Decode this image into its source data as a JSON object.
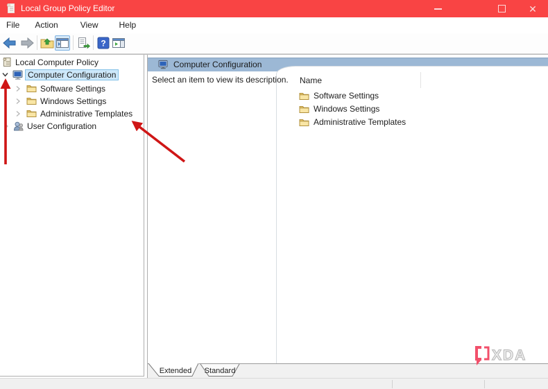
{
  "window": {
    "title": "Local Group Policy Editor",
    "controls": {
      "minimize": "minimize",
      "maximize": "maximize",
      "close": "close"
    }
  },
  "menu": {
    "items": [
      {
        "label": "File"
      },
      {
        "label": "Action"
      },
      {
        "label": "View"
      },
      {
        "label": "Help"
      }
    ]
  },
  "toolbar": {
    "buttons": [
      {
        "name": "back"
      },
      {
        "name": "forward"
      },
      {
        "name": "up-one-level"
      },
      {
        "name": "show-console-tree",
        "pressed": true
      },
      {
        "name": "export-list"
      },
      {
        "name": "help"
      },
      {
        "name": "show-action-pane"
      }
    ],
    "help_glyph": "?"
  },
  "tree": {
    "root": {
      "label": "Local Computer Policy"
    },
    "computer": {
      "label": "Computer Configuration",
      "selected": true,
      "expanded": true,
      "children": [
        {
          "label": "Software Settings"
        },
        {
          "label": "Windows Settings"
        },
        {
          "label": "Administrative Templates"
        }
      ]
    },
    "user": {
      "label": "User Configuration"
    }
  },
  "content": {
    "header": {
      "title": "Computer Configuration"
    },
    "description": "Select an item to view its description.",
    "list": {
      "column_header": "Name",
      "items": [
        {
          "label": "Software Settings"
        },
        {
          "label": "Windows Settings"
        },
        {
          "label": "Administrative Templates"
        }
      ]
    }
  },
  "tabs": {
    "extended": "Extended",
    "standard": "Standard"
  },
  "watermark": {
    "text": "XDA"
  },
  "colors": {
    "titlebar_red": "#F94444",
    "header_strip_blue": "#9CB8D5",
    "selection_bg": "#CDE8FA",
    "selection_border": "#84C1E8",
    "annotation_arrow_red": "#CF1616",
    "watermark_pink": "#F2506B",
    "folder_yellow": "#F7DD8F"
  }
}
